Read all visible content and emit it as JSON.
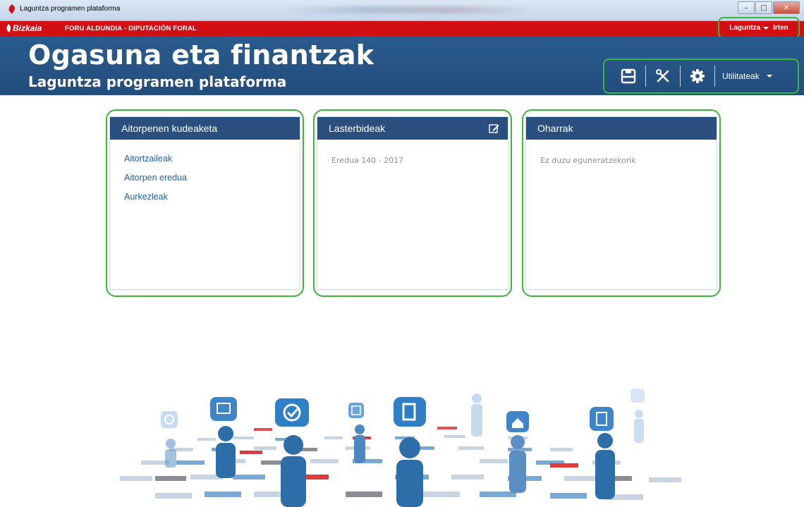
{
  "window": {
    "title": "Laguntza programen plataforma",
    "buttons": [
      "–",
      "□",
      "✕"
    ]
  },
  "brandbar": {
    "brand": "Bizkaia",
    "org": "FORU ALDUNDIA - DIPUTACIÓN FORAL",
    "help": "Laguntza",
    "exit": "Irten"
  },
  "header": {
    "title": "Ogasuna eta finantzak",
    "subtitle": "Laguntza programen plataforma"
  },
  "toolbar": {
    "save_icon": "save-icon",
    "tools_icon": "tools-icon",
    "settings_icon": "gear-icon",
    "utilities": "Utilitateak"
  },
  "panels": {
    "declarations": {
      "title": "Aitorpenen kudeaketa",
      "links": [
        "Aitortzaileak",
        "Aitorpen eredua",
        "Aurkezleak"
      ]
    },
    "shortcuts": {
      "title": "Lasterbideak",
      "items": [
        "Eredua 140 - 2017"
      ]
    },
    "notes": {
      "title": "Oharrak",
      "empty": "Ez duzu eguneratzekorik"
    }
  },
  "colors": {
    "red": "#d30f14",
    "header_blue": "#2a5b8e",
    "panel_head": "#2a4f7f",
    "link": "#1f5fa6",
    "highlight": "#3bb53b"
  }
}
